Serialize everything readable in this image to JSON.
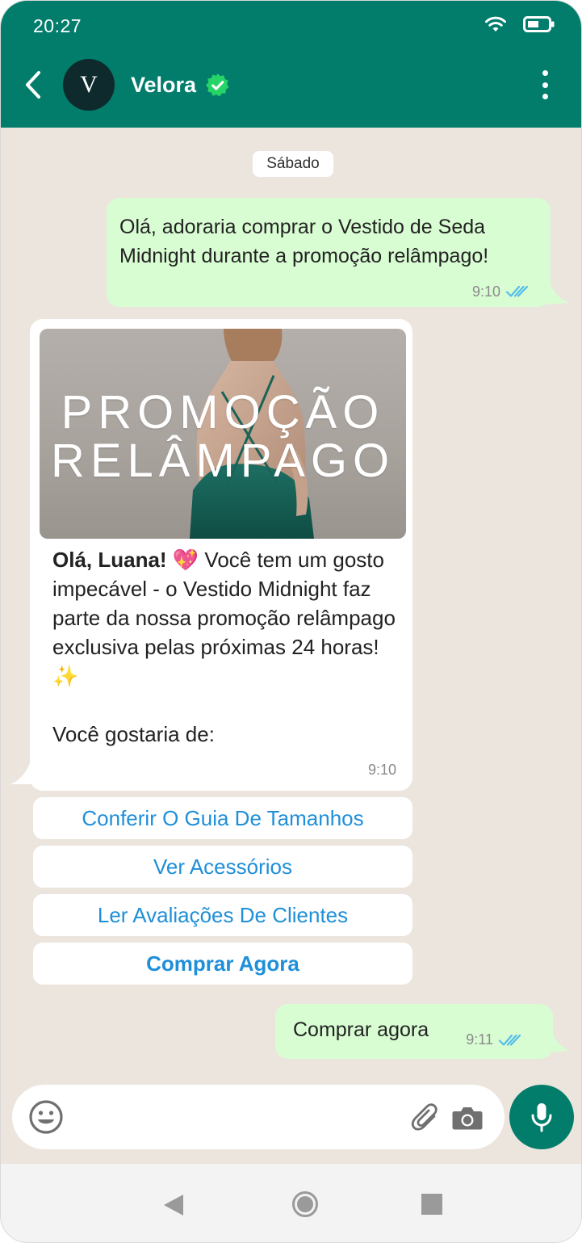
{
  "status": {
    "time": "20:27"
  },
  "contact": {
    "avatar_letter": "V",
    "name": "Velora",
    "verified": true
  },
  "chat": {
    "date_label": "Sábado",
    "messages": [
      {
        "direction": "outgoing",
        "text": "Olá, adoraria comprar o Vestido de Seda Midnight durante a promoção relâmpago!",
        "time": "9:10",
        "status": "read"
      },
      {
        "direction": "incoming",
        "image_text_line1": "PROMOÇÃO",
        "image_text_line2": "RELÂMPAGO",
        "greeting": "Olá, Luana!",
        "emoji1": "💖",
        "body": " Você tem um gosto impecável - o Vestido Midnight faz parte da nossa promoção relâmpago exclusiva pelas próximas 24 horas! ",
        "emoji2": "✨",
        "question": "Você gostaria de:",
        "time": "9:10"
      },
      {
        "direction": "outgoing",
        "text": "Comprar agora",
        "time": "9:11",
        "status": "read"
      }
    ],
    "quick_replies": [
      {
        "label": "Conferir O Guia De Tamanhos",
        "bold": false
      },
      {
        "label": "Ver Acessórios",
        "bold": false
      },
      {
        "label": "Ler Avaliações De Clientes",
        "bold": false
      },
      {
        "label": "Comprar Agora",
        "bold": true
      }
    ]
  },
  "composer": {
    "value": "",
    "placeholder": ""
  },
  "colors": {
    "header": "#027d6b",
    "outgoing_bubble": "#d9fdd3",
    "chat_bg": "#ece5dd",
    "link": "#1f8fd9",
    "verified": "#25d366",
    "read_ticks": "#53bdeb"
  }
}
